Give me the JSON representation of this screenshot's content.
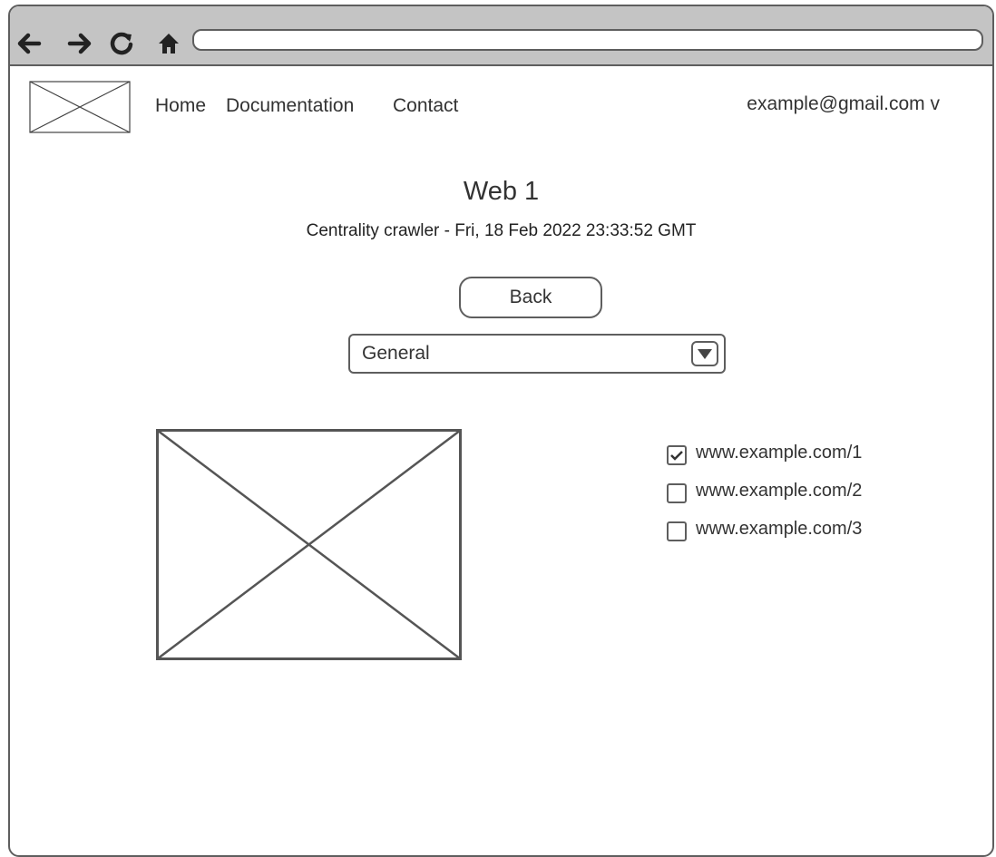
{
  "browser": {
    "back_icon": "arrow-left-icon",
    "forward_icon": "arrow-right-icon",
    "reload_icon": "reload-icon",
    "home_icon": "home-icon",
    "url": ""
  },
  "header": {
    "logo": "image-placeholder",
    "nav": [
      {
        "label": "Home"
      },
      {
        "label": "Documentation"
      },
      {
        "label": "Contact"
      }
    ],
    "user_menu": "example@gmail.com v"
  },
  "main": {
    "title": "Web 1",
    "subtitle": "Centrality crawler - Fri, 18 Feb 2022 23:33:52 GMT",
    "back_label": "Back",
    "dropdown": {
      "selected": "General",
      "icon": "dropdown-arrow-icon"
    },
    "image": "image-placeholder",
    "links": [
      {
        "label": "www.example.com/1",
        "checked": true
      },
      {
        "label": "www.example.com/2",
        "checked": false
      },
      {
        "label": "www.example.com/3",
        "checked": false
      }
    ]
  },
  "colors": {
    "chrome": "#c4c4c4",
    "stroke": "#5e5e5e",
    "text": "#333333"
  }
}
